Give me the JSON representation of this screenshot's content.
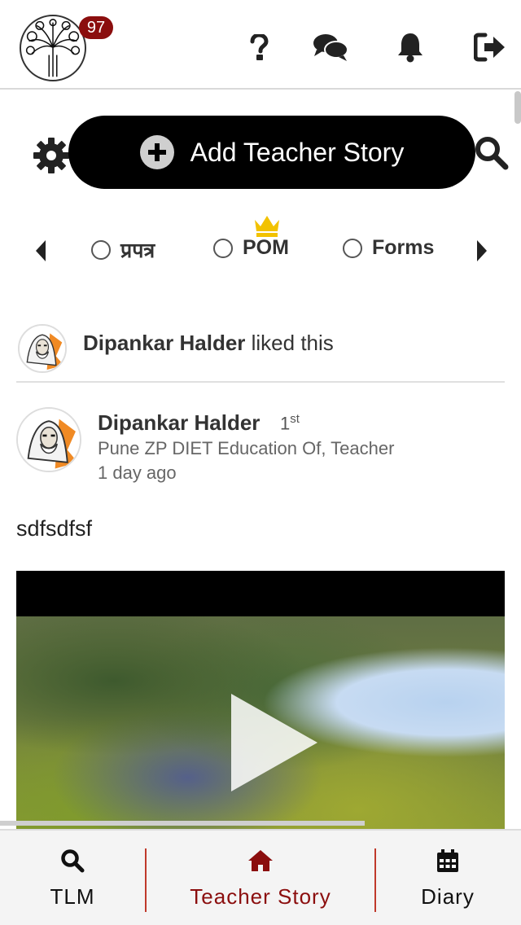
{
  "header": {
    "notification_count": "97",
    "icons": [
      "logo-tree-icon",
      "question-icon",
      "chat-icon",
      "bell-icon",
      "logout-icon"
    ]
  },
  "actions": {
    "add_story_label": "Add Teacher Story"
  },
  "filters": [
    {
      "label": "प्रपत्र",
      "selected": false
    },
    {
      "label": "POM",
      "selected": false,
      "premium": true
    },
    {
      "label": "Forms",
      "selected": false
    }
  ],
  "feed": {
    "activity": {
      "name": "Dipankar Halder",
      "action": " liked this"
    },
    "post": {
      "author": "Dipankar Halder",
      "degree": "1",
      "degree_suffix": "st",
      "role": "Pune ZP DIET Education Of, Teacher",
      "time": "1 day ago",
      "text": "sdfsdfsf",
      "video_progress": 0.75
    }
  },
  "bottom_nav": [
    {
      "label": "TLM",
      "icon": "search-icon",
      "active": false
    },
    {
      "label": "Teacher Story",
      "icon": "home-icon",
      "active": true
    },
    {
      "label": "Diary",
      "icon": "calendar-icon",
      "active": false
    }
  ],
  "colors": {
    "brand": "#8b0e0e",
    "button_bg": "#000000",
    "crown": "#f2c200"
  }
}
